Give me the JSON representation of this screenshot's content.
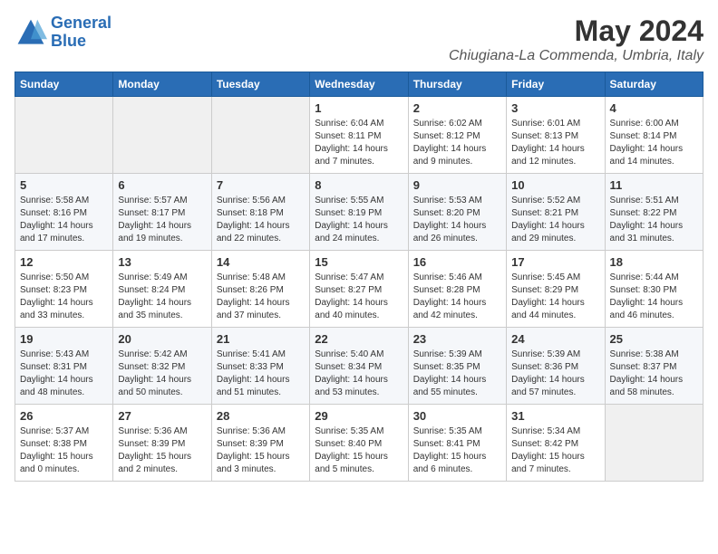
{
  "logo": {
    "line1": "General",
    "line2": "Blue"
  },
  "title": "May 2024",
  "subtitle": "Chiugiana-La Commenda, Umbria, Italy",
  "days_of_week": [
    "Sunday",
    "Monday",
    "Tuesday",
    "Wednesday",
    "Thursday",
    "Friday",
    "Saturday"
  ],
  "weeks": [
    [
      {
        "day": "",
        "empty": true
      },
      {
        "day": "",
        "empty": true
      },
      {
        "day": "",
        "empty": true
      },
      {
        "day": "1",
        "sunrise": "6:04 AM",
        "sunset": "8:11 PM",
        "daylight": "14 hours and 7 minutes."
      },
      {
        "day": "2",
        "sunrise": "6:02 AM",
        "sunset": "8:12 PM",
        "daylight": "14 hours and 9 minutes."
      },
      {
        "day": "3",
        "sunrise": "6:01 AM",
        "sunset": "8:13 PM",
        "daylight": "14 hours and 12 minutes."
      },
      {
        "day": "4",
        "sunrise": "6:00 AM",
        "sunset": "8:14 PM",
        "daylight": "14 hours and 14 minutes."
      }
    ],
    [
      {
        "day": "5",
        "sunrise": "5:58 AM",
        "sunset": "8:16 PM",
        "daylight": "14 hours and 17 minutes."
      },
      {
        "day": "6",
        "sunrise": "5:57 AM",
        "sunset": "8:17 PM",
        "daylight": "14 hours and 19 minutes."
      },
      {
        "day": "7",
        "sunrise": "5:56 AM",
        "sunset": "8:18 PM",
        "daylight": "14 hours and 22 minutes."
      },
      {
        "day": "8",
        "sunrise": "5:55 AM",
        "sunset": "8:19 PM",
        "daylight": "14 hours and 24 minutes."
      },
      {
        "day": "9",
        "sunrise": "5:53 AM",
        "sunset": "8:20 PM",
        "daylight": "14 hours and 26 minutes."
      },
      {
        "day": "10",
        "sunrise": "5:52 AM",
        "sunset": "8:21 PM",
        "daylight": "14 hours and 29 minutes."
      },
      {
        "day": "11",
        "sunrise": "5:51 AM",
        "sunset": "8:22 PM",
        "daylight": "14 hours and 31 minutes."
      }
    ],
    [
      {
        "day": "12",
        "sunrise": "5:50 AM",
        "sunset": "8:23 PM",
        "daylight": "14 hours and 33 minutes."
      },
      {
        "day": "13",
        "sunrise": "5:49 AM",
        "sunset": "8:24 PM",
        "daylight": "14 hours and 35 minutes."
      },
      {
        "day": "14",
        "sunrise": "5:48 AM",
        "sunset": "8:26 PM",
        "daylight": "14 hours and 37 minutes."
      },
      {
        "day": "15",
        "sunrise": "5:47 AM",
        "sunset": "8:27 PM",
        "daylight": "14 hours and 40 minutes."
      },
      {
        "day": "16",
        "sunrise": "5:46 AM",
        "sunset": "8:28 PM",
        "daylight": "14 hours and 42 minutes."
      },
      {
        "day": "17",
        "sunrise": "5:45 AM",
        "sunset": "8:29 PM",
        "daylight": "14 hours and 44 minutes."
      },
      {
        "day": "18",
        "sunrise": "5:44 AM",
        "sunset": "8:30 PM",
        "daylight": "14 hours and 46 minutes."
      }
    ],
    [
      {
        "day": "19",
        "sunrise": "5:43 AM",
        "sunset": "8:31 PM",
        "daylight": "14 hours and 48 minutes."
      },
      {
        "day": "20",
        "sunrise": "5:42 AM",
        "sunset": "8:32 PM",
        "daylight": "14 hours and 50 minutes."
      },
      {
        "day": "21",
        "sunrise": "5:41 AM",
        "sunset": "8:33 PM",
        "daylight": "14 hours and 51 minutes."
      },
      {
        "day": "22",
        "sunrise": "5:40 AM",
        "sunset": "8:34 PM",
        "daylight": "14 hours and 53 minutes."
      },
      {
        "day": "23",
        "sunrise": "5:39 AM",
        "sunset": "8:35 PM",
        "daylight": "14 hours and 55 minutes."
      },
      {
        "day": "24",
        "sunrise": "5:39 AM",
        "sunset": "8:36 PM",
        "daylight": "14 hours and 57 minutes."
      },
      {
        "day": "25",
        "sunrise": "5:38 AM",
        "sunset": "8:37 PM",
        "daylight": "14 hours and 58 minutes."
      }
    ],
    [
      {
        "day": "26",
        "sunrise": "5:37 AM",
        "sunset": "8:38 PM",
        "daylight": "15 hours and 0 minutes."
      },
      {
        "day": "27",
        "sunrise": "5:36 AM",
        "sunset": "8:39 PM",
        "daylight": "15 hours and 2 minutes."
      },
      {
        "day": "28",
        "sunrise": "5:36 AM",
        "sunset": "8:39 PM",
        "daylight": "15 hours and 3 minutes."
      },
      {
        "day": "29",
        "sunrise": "5:35 AM",
        "sunset": "8:40 PM",
        "daylight": "15 hours and 5 minutes."
      },
      {
        "day": "30",
        "sunrise": "5:35 AM",
        "sunset": "8:41 PM",
        "daylight": "15 hours and 6 minutes."
      },
      {
        "day": "31",
        "sunrise": "5:34 AM",
        "sunset": "8:42 PM",
        "daylight": "15 hours and 7 minutes."
      },
      {
        "day": "",
        "empty": true
      }
    ]
  ]
}
